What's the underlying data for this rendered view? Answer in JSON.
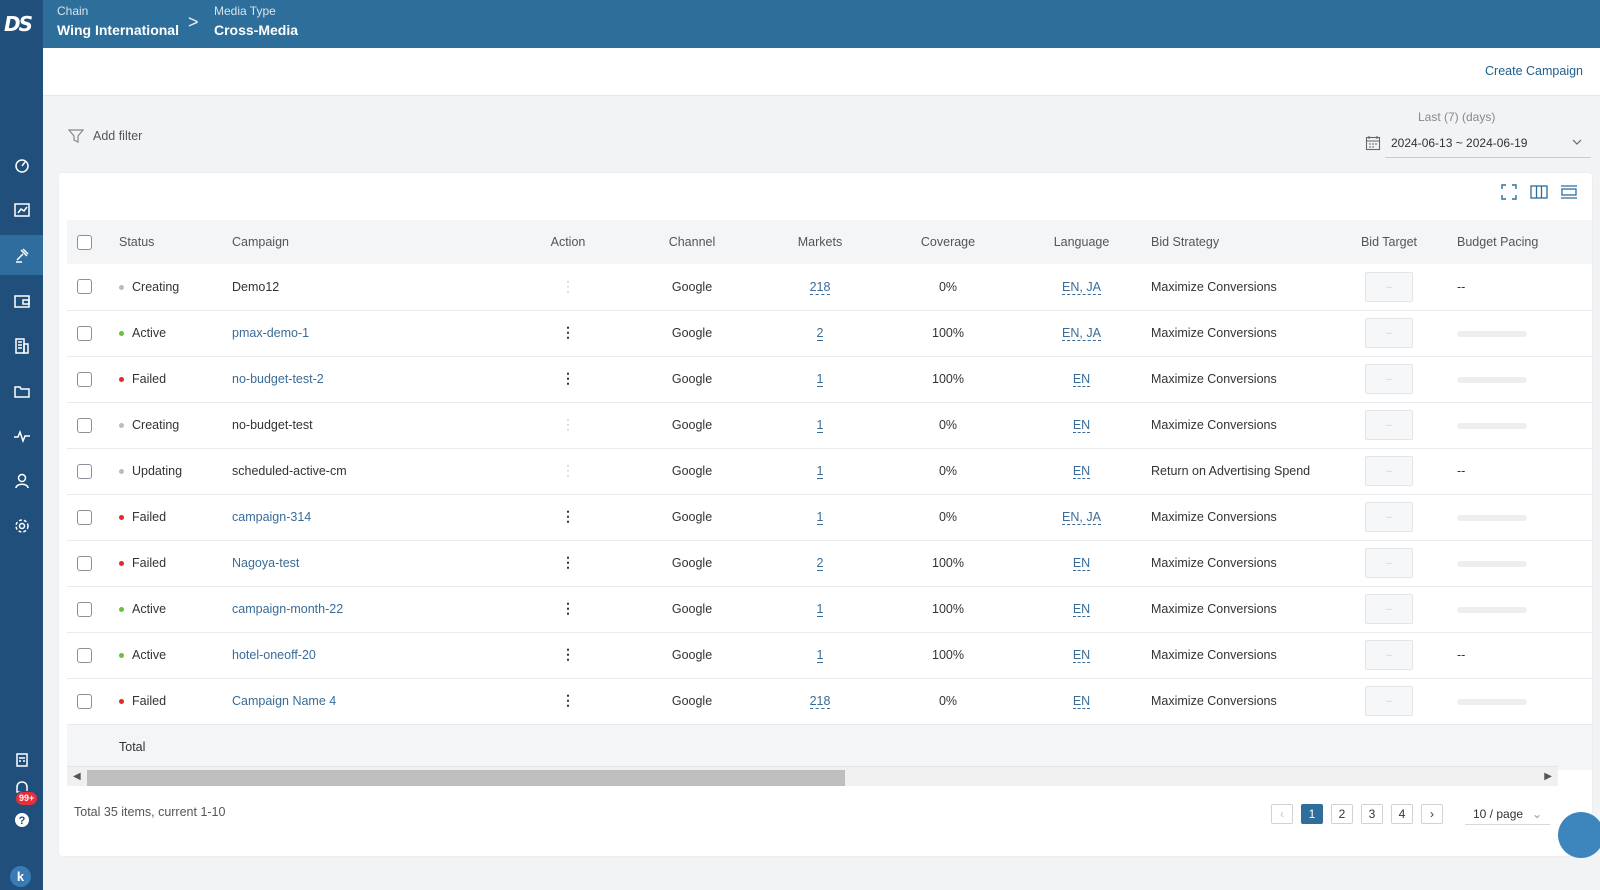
{
  "app": {
    "logo_text": "DS"
  },
  "header": {
    "crumbs": [
      {
        "label": "Chain",
        "value": "Wing International"
      },
      {
        "label": "Media Type",
        "value": "Cross-Media"
      }
    ],
    "separator": ">"
  },
  "subbar": {
    "create_label": "Create Campaign"
  },
  "filter": {
    "add_filter_label": "Add filter"
  },
  "date": {
    "caption": "Last (7) (days)",
    "range": "2024-06-13 ~ 2024-06-19"
  },
  "notifications": {
    "badge": "99+"
  },
  "user": {
    "initial": "k"
  },
  "table": {
    "headers": [
      "Status",
      "Campaign",
      "Action",
      "Channel",
      "Markets",
      "Coverage",
      "Language",
      "Bid Strategy",
      "Bid Target",
      "Budget Pacing"
    ],
    "rows": [
      {
        "status": "Creating",
        "status_color": "#b9bcc0",
        "campaign": "Demo12",
        "campaign_link": false,
        "action_enabled": false,
        "channel": "Google",
        "markets": "218",
        "coverage": "0%",
        "language": "EN, JA",
        "bid_strategy": "Maximize Conversions",
        "bid_target": "--",
        "pacing": "--"
      },
      {
        "status": "Active",
        "status_color": "#6bbf3b",
        "campaign": "pmax-demo-1",
        "campaign_link": true,
        "action_enabled": true,
        "channel": "Google",
        "markets": "2",
        "coverage": "100%",
        "language": "EN, JA",
        "bid_strategy": "Maximize Conversions",
        "bid_target": "--",
        "pacing": ""
      },
      {
        "status": "Failed",
        "status_color": "#e02b2b",
        "campaign": "no-budget-test-2",
        "campaign_link": true,
        "action_enabled": true,
        "channel": "Google",
        "markets": "1",
        "coverage": "100%",
        "language": "EN",
        "bid_strategy": "Maximize Conversions",
        "bid_target": "--",
        "pacing": ""
      },
      {
        "status": "Creating",
        "status_color": "#b9bcc0",
        "campaign": "no-budget-test",
        "campaign_link": false,
        "action_enabled": false,
        "channel": "Google",
        "markets": "1",
        "coverage": "0%",
        "language": "EN",
        "bid_strategy": "Maximize Conversions",
        "bid_target": "--",
        "pacing": ""
      },
      {
        "status": "Updating",
        "status_color": "#b9bcc0",
        "campaign": "scheduled-active-cm",
        "campaign_link": false,
        "action_enabled": false,
        "channel": "Google",
        "markets": "1",
        "coverage": "0%",
        "language": "EN",
        "bid_strategy": "Return on Advertising Spend",
        "bid_target": "--",
        "pacing": "--"
      },
      {
        "status": "Failed",
        "status_color": "#e02b2b",
        "campaign": "campaign-314",
        "campaign_link": true,
        "action_enabled": true,
        "channel": "Google",
        "markets": "1",
        "coverage": "0%",
        "language": "EN, JA",
        "bid_strategy": "Maximize Conversions",
        "bid_target": "--",
        "pacing": ""
      },
      {
        "status": "Failed",
        "status_color": "#e02b2b",
        "campaign": "Nagoya-test",
        "campaign_link": true,
        "action_enabled": true,
        "channel": "Google",
        "markets": "2",
        "coverage": "100%",
        "language": "EN",
        "bid_strategy": "Maximize Conversions",
        "bid_target": "--",
        "pacing": ""
      },
      {
        "status": "Active",
        "status_color": "#6bbf3b",
        "campaign": "campaign-month-22",
        "campaign_link": true,
        "action_enabled": true,
        "channel": "Google",
        "markets": "1",
        "coverage": "100%",
        "language": "EN",
        "bid_strategy": "Maximize Conversions",
        "bid_target": "--",
        "pacing": ""
      },
      {
        "status": "Active",
        "status_color": "#6bbf3b",
        "campaign": "hotel-oneoff-20",
        "campaign_link": true,
        "action_enabled": true,
        "channel": "Google",
        "markets": "1",
        "coverage": "100%",
        "language": "EN",
        "bid_strategy": "Maximize Conversions",
        "bid_target": "--",
        "pacing": "--"
      },
      {
        "status": "Failed",
        "status_color": "#e02b2b",
        "campaign": "Campaign Name 4",
        "campaign_link": true,
        "action_enabled": true,
        "channel": "Google",
        "markets": "218",
        "coverage": "0%",
        "language": "EN",
        "bid_strategy": "Maximize Conversions",
        "bid_target": "--",
        "pacing": ""
      }
    ],
    "total_label": "Total"
  },
  "pagination": {
    "summary": "Total 35 items, current 1-10",
    "pages": [
      "1",
      "2",
      "3",
      "4"
    ],
    "current": "1",
    "page_size": "10 / page"
  },
  "colors": {
    "sidebar": "#1f4f7a",
    "header": "#2d6e9a",
    "accent": "#3a6c97"
  }
}
